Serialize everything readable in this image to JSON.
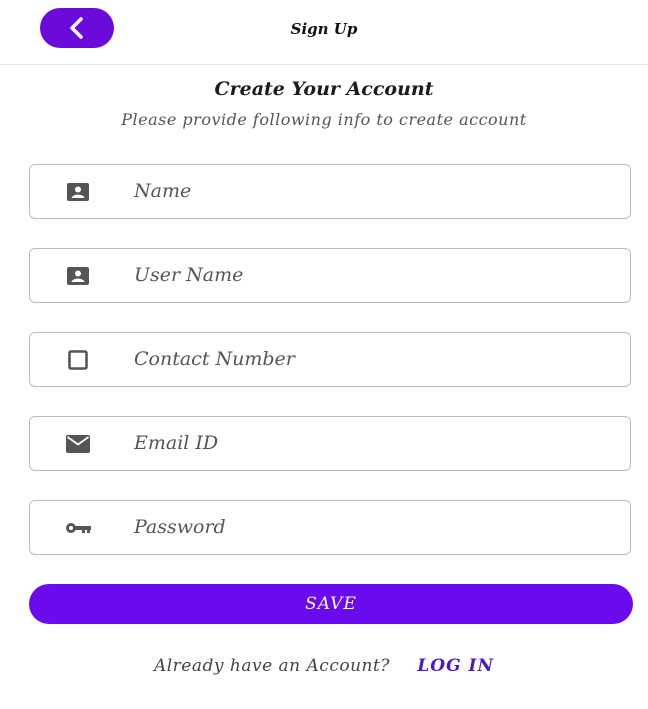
{
  "topbar": {
    "back_icon": "chevron-left-icon",
    "title": "Sign Up",
    "accent": "#6a0bdc"
  },
  "header": {
    "title": "Create Your Account",
    "subtitle": "Please provide following info to create account"
  },
  "form": {
    "fields": [
      {
        "id": "name",
        "icon": "contact-card-icon",
        "placeholder": "Name",
        "value": ""
      },
      {
        "id": "username",
        "icon": "contact-card-icon",
        "placeholder": "User Name",
        "value": ""
      },
      {
        "id": "contact",
        "icon": "square-outline-icon",
        "placeholder": "Contact Number",
        "value": ""
      },
      {
        "id": "email",
        "icon": "envelope-icon",
        "placeholder": "Email ID",
        "value": ""
      },
      {
        "id": "password",
        "icon": "key-icon",
        "placeholder": "Password",
        "value": ""
      }
    ],
    "save_label": "SAVE",
    "button_color": "#6a0bee"
  },
  "footer": {
    "question": "Already have an Account?",
    "login_label": "LOG IN",
    "link_color": "#4a18c9"
  }
}
